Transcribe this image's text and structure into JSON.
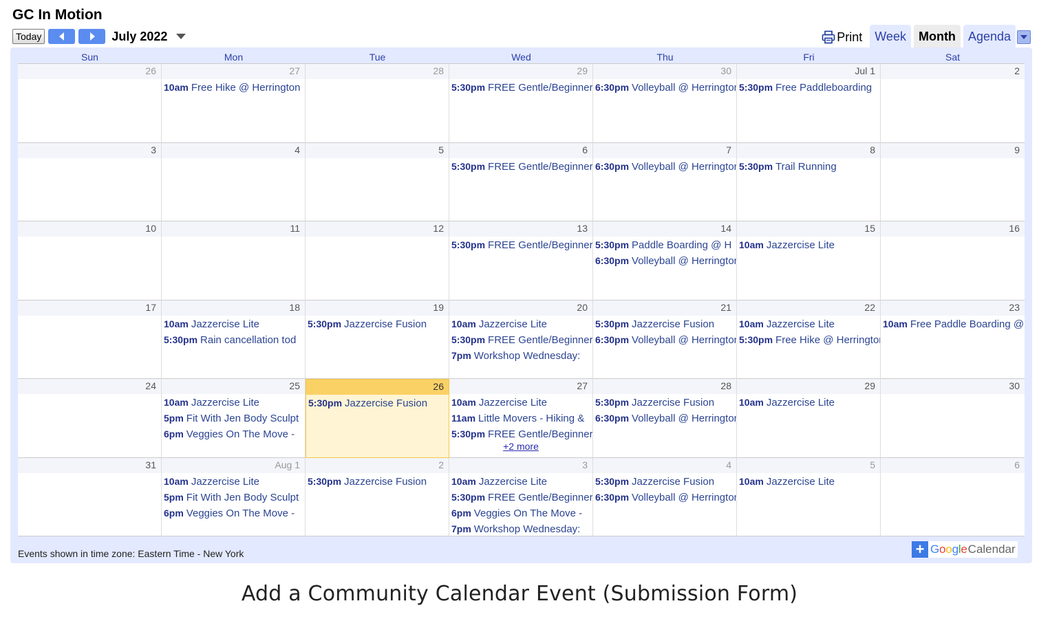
{
  "calendar_title": "GC In Motion",
  "nav": {
    "today_label": "Today",
    "month_label": "July 2022"
  },
  "views": {
    "print_label": "Print",
    "week_label": "Week",
    "month_label": "Month",
    "agenda_label": "Agenda"
  },
  "weekdays": [
    "Sun",
    "Mon",
    "Tue",
    "Wed",
    "Thu",
    "Fri",
    "Sat"
  ],
  "weeks": [
    [
      {
        "day": "26",
        "other": true,
        "events": []
      },
      {
        "day": "27",
        "other": true,
        "events": [
          {
            "time": "10am",
            "title": "Free Hike @ Herrington"
          }
        ]
      },
      {
        "day": "28",
        "other": true,
        "events": []
      },
      {
        "day": "29",
        "other": true,
        "events": [
          {
            "time": "5:30pm",
            "title": "FREE Gentle/Beginner"
          }
        ]
      },
      {
        "day": "30",
        "other": true,
        "events": [
          {
            "time": "6:30pm",
            "title": "Volleyball @ Herrington"
          }
        ]
      },
      {
        "day": "Jul 1",
        "events": [
          {
            "time": "5:30pm",
            "title": "Free Paddleboarding"
          }
        ]
      },
      {
        "day": "2",
        "events": []
      }
    ],
    [
      {
        "day": "3",
        "events": []
      },
      {
        "day": "4",
        "events": []
      },
      {
        "day": "5",
        "events": []
      },
      {
        "day": "6",
        "events": [
          {
            "time": "5:30pm",
            "title": "FREE Gentle/Beginner"
          }
        ]
      },
      {
        "day": "7",
        "events": [
          {
            "time": "6:30pm",
            "title": "Volleyball @ Herrington"
          }
        ]
      },
      {
        "day": "8",
        "events": [
          {
            "time": "5:30pm",
            "title": "Trail Running"
          }
        ]
      },
      {
        "day": "9",
        "events": []
      }
    ],
    [
      {
        "day": "10",
        "events": []
      },
      {
        "day": "11",
        "events": []
      },
      {
        "day": "12",
        "events": []
      },
      {
        "day": "13",
        "events": [
          {
            "time": "5:30pm",
            "title": "FREE Gentle/Beginner"
          }
        ]
      },
      {
        "day": "14",
        "events": [
          {
            "time": "5:30pm",
            "title": "Paddle Boarding @ H"
          },
          {
            "time": "6:30pm",
            "title": "Volleyball @ Herrington"
          }
        ]
      },
      {
        "day": "15",
        "events": [
          {
            "time": "10am",
            "title": "Jazzercise Lite"
          }
        ]
      },
      {
        "day": "16",
        "events": []
      }
    ],
    [
      {
        "day": "17",
        "events": []
      },
      {
        "day": "18",
        "events": [
          {
            "time": "10am",
            "title": "Jazzercise Lite"
          },
          {
            "time": "5:30pm",
            "title": "Rain cancellation tod"
          }
        ]
      },
      {
        "day": "19",
        "events": [
          {
            "time": "5:30pm",
            "title": "Jazzercise Fusion"
          }
        ]
      },
      {
        "day": "20",
        "events": [
          {
            "time": "10am",
            "title": "Jazzercise Lite"
          },
          {
            "time": "5:30pm",
            "title": "FREE Gentle/Beginner"
          },
          {
            "time": "7pm",
            "title": "Workshop Wednesday:"
          }
        ]
      },
      {
        "day": "21",
        "events": [
          {
            "time": "5:30pm",
            "title": "Jazzercise Fusion"
          },
          {
            "time": "6:30pm",
            "title": "Volleyball @ Herrington"
          }
        ]
      },
      {
        "day": "22",
        "events": [
          {
            "time": "10am",
            "title": "Jazzercise Lite"
          },
          {
            "time": "5:30pm",
            "title": "Free Hike @ Herrington"
          }
        ]
      },
      {
        "day": "23",
        "events": [
          {
            "time": "10am",
            "title": "Free Paddle Boarding @"
          }
        ]
      }
    ],
    [
      {
        "day": "24",
        "events": []
      },
      {
        "day": "25",
        "events": [
          {
            "time": "10am",
            "title": "Jazzercise Lite"
          },
          {
            "time": "5pm",
            "title": "Fit With Jen Body Sculpt"
          },
          {
            "time": "6pm",
            "title": "Veggies On The Move -"
          }
        ]
      },
      {
        "day": "26",
        "today": true,
        "events": [
          {
            "time": "5:30pm",
            "title": "Jazzercise Fusion"
          }
        ]
      },
      {
        "day": "27",
        "events": [
          {
            "time": "10am",
            "title": "Jazzercise Lite"
          },
          {
            "time": "11am",
            "title": "Little Movers - Hiking &"
          },
          {
            "time": "5:30pm",
            "title": "FREE Gentle/Beginner"
          }
        ],
        "more": "+2 more"
      },
      {
        "day": "28",
        "events": [
          {
            "time": "5:30pm",
            "title": "Jazzercise Fusion"
          },
          {
            "time": "6:30pm",
            "title": "Volleyball @ Herrington"
          }
        ]
      },
      {
        "day": "29",
        "events": [
          {
            "time": "10am",
            "title": "Jazzercise Lite"
          }
        ]
      },
      {
        "day": "30",
        "events": []
      }
    ],
    [
      {
        "day": "31",
        "events": []
      },
      {
        "day": "Aug 1",
        "other": true,
        "events": [
          {
            "time": "10am",
            "title": "Jazzercise Lite"
          },
          {
            "time": "5pm",
            "title": "Fit With Jen Body Sculpt"
          },
          {
            "time": "6pm",
            "title": "Veggies On The Move -"
          }
        ]
      },
      {
        "day": "2",
        "other": true,
        "events": [
          {
            "time": "5:30pm",
            "title": "Jazzercise Fusion"
          }
        ]
      },
      {
        "day": "3",
        "other": true,
        "events": [
          {
            "time": "10am",
            "title": "Jazzercise Lite"
          },
          {
            "time": "5:30pm",
            "title": "FREE Gentle/Beginner"
          },
          {
            "time": "6pm",
            "title": "Veggies On The Move -"
          },
          {
            "time": "7pm",
            "title": "Workshop Wednesday:"
          }
        ]
      },
      {
        "day": "4",
        "other": true,
        "events": [
          {
            "time": "5:30pm",
            "title": "Jazzercise Fusion"
          },
          {
            "time": "6:30pm",
            "title": "Volleyball @ Herrington"
          }
        ]
      },
      {
        "day": "5",
        "other": true,
        "events": [
          {
            "time": "10am",
            "title": "Jazzercise Lite"
          }
        ]
      },
      {
        "day": "6",
        "other": true,
        "events": []
      }
    ]
  ],
  "timezone_note": "Events shown in time zone: Eastern Time - New York",
  "badge": {
    "plus": "+",
    "google_letters": [
      "G",
      "o",
      "o",
      "g",
      "l",
      "e"
    ],
    "google_colors": [
      "#4285f4",
      "#ea4335",
      "#fbbc05",
      "#4285f4",
      "#34a853",
      "#ea4335"
    ],
    "calendar_word": "Calendar"
  },
  "submission_link": "Add a Community Calendar Event (Submission Form)",
  "colors": {
    "accent_blue": "#5b8cf0",
    "frame_bg": "#e3e9ff",
    "today_header": "#fad165",
    "today_bg": "#fff4d3",
    "event_text": "#2c4593"
  }
}
